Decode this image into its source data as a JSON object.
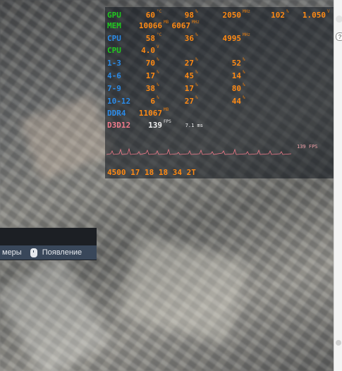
{
  "overlay": {
    "rows": [
      {
        "label": "GPU",
        "label_color": "green",
        "values": [
          {
            "v": "60",
            "u": "°C"
          },
          {
            "v": "98",
            "u": "%"
          },
          {
            "v": "2050",
            "u": "MHz"
          },
          {
            "v": "102",
            "u": "%"
          },
          {
            "v": "1.050",
            "u": "V"
          }
        ]
      },
      {
        "label": "MEM",
        "label_color": "green",
        "values": [
          {
            "v": "10066",
            "u": "MB"
          },
          {
            "v": "6067",
            "u": "MHz"
          }
        ]
      },
      {
        "label": "CPU",
        "label_color": "blue",
        "values": [
          {
            "v": "58",
            "u": "°C"
          },
          {
            "v": "36",
            "u": "%"
          },
          {
            "v": "4995",
            "u": "MHz"
          }
        ]
      },
      {
        "label": "CPU",
        "label_color": "green",
        "values": [
          {
            "v": "4.0",
            "u": "V"
          }
        ]
      },
      {
        "label": "1-3",
        "label_color": "blue",
        "values": [
          {
            "v": "70",
            "u": "%"
          },
          {
            "v": "27",
            "u": "%"
          },
          {
            "v": "52",
            "u": "%"
          }
        ]
      },
      {
        "label": "4-6",
        "label_color": "blue",
        "values": [
          {
            "v": "17",
            "u": "%"
          },
          {
            "v": "45",
            "u": "%"
          },
          {
            "v": "14",
            "u": "%"
          }
        ]
      },
      {
        "label": "7-9",
        "label_color": "blue",
        "values": [
          {
            "v": "38",
            "u": "%"
          },
          {
            "v": "17",
            "u": "%"
          },
          {
            "v": "80",
            "u": "%"
          }
        ]
      },
      {
        "label": "10-12",
        "label_color": "blue",
        "values": [
          {
            "v": "6",
            "u": "%"
          },
          {
            "v": "27",
            "u": "%"
          },
          {
            "v": "44",
            "u": "%"
          }
        ]
      },
      {
        "label": "DDR4",
        "label_color": "blue",
        "values": [
          {
            "v": "11067",
            "u": "MB"
          }
        ]
      },
      {
        "label": "D3D12",
        "label_color": "pink",
        "values": [
          {
            "v": "139",
            "u": "FPS"
          },
          {
            "v": "7.1 ms",
            "u": ""
          }
        ]
      }
    ],
    "graph_label": "139 FPS",
    "timings": "4500 17 18 18 34 2T"
  },
  "game_menu": {
    "left_text": "меры",
    "right_text": "Появление",
    "mouse_icon": "mouse-icon"
  },
  "sidebar": {
    "icon": "?"
  }
}
